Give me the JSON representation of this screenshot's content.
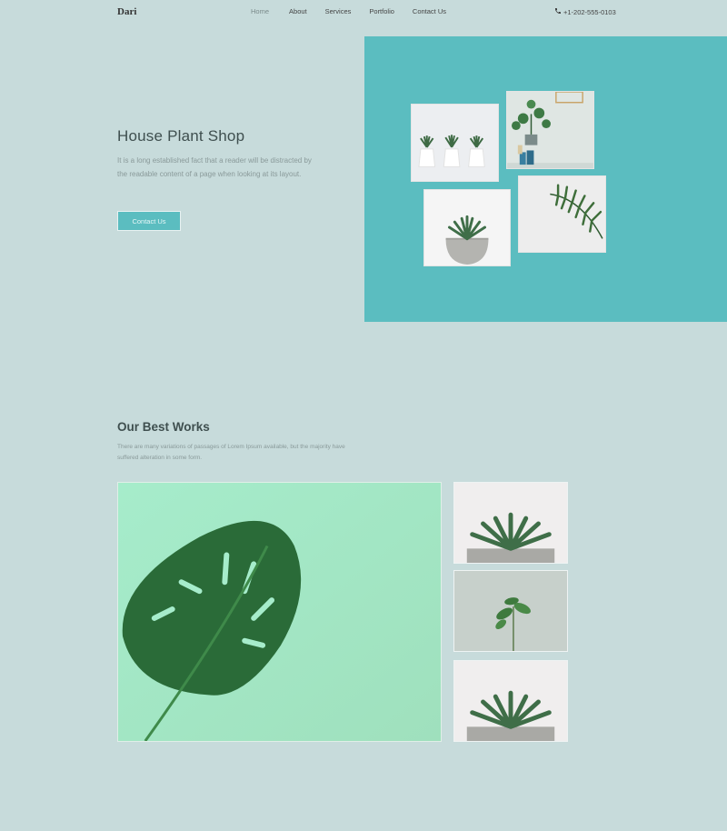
{
  "header": {
    "brand": "Dari",
    "nav": [
      "Home",
      "About",
      "Services",
      "Portfolio",
      "Contact Us"
    ],
    "active_nav": "Home",
    "phone_icon": "phone-icon",
    "phone": "+1-202-555-0103"
  },
  "hero": {
    "title": "House Plant Shop",
    "text": "It is a long established fact that a reader will be distracted by the readable content of a page when looking at its layout.",
    "button": "Contact Us",
    "panel_color": "#5bbdc0"
  },
  "works": {
    "title": "Our Best Works",
    "text": "There are many variations of passages of Lorem Ipsum available, but the majority have suffered alteration in some form."
  },
  "colors": {
    "background": "#c7dbdb",
    "accent": "#5bbdc0"
  }
}
